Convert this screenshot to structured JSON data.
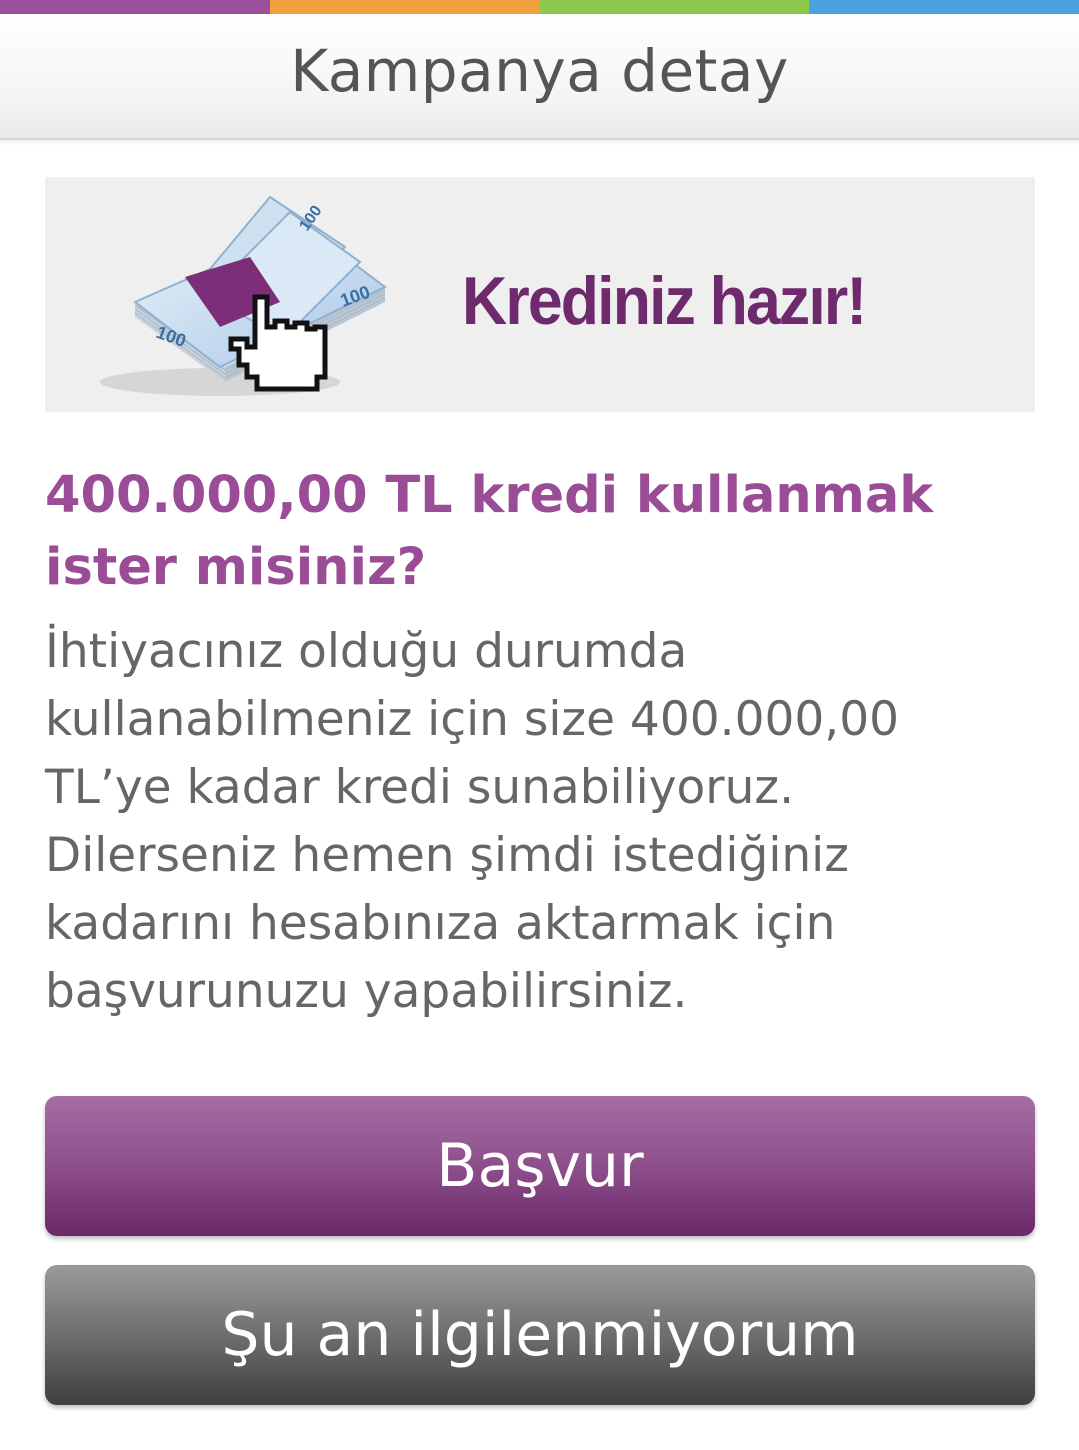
{
  "top_bar": {
    "colors": [
      "#9c4f9b",
      "#f0a13c",
      "#8cc84b",
      "#4aa3df"
    ]
  },
  "header": {
    "title": "Kampanya detay"
  },
  "banner": {
    "text": "Krediniz hazır!",
    "image_icon": "money-stack-with-hand-cursor-icon",
    "note_label": "100"
  },
  "offer": {
    "headline": "400.000,00 TL kredi kullanmak ister misiniz?",
    "description": "İhtiyacınız olduğu durumda kullanabilmeniz için size 400.000,00 TL’ye kadar kredi sunabiliyoruz. Dilerseniz hemen şimdi istediğiniz kadarını hesabınıza aktarmak için başvurunuzu yapabilirsiniz."
  },
  "actions": {
    "apply_label": "Başvur",
    "decline_label": "Şu an ilgilenmiyorum"
  },
  "colors": {
    "accent_purple": "#9a4d96",
    "brand_purple_dark": "#6e2a6d",
    "body_text": "#666666"
  }
}
